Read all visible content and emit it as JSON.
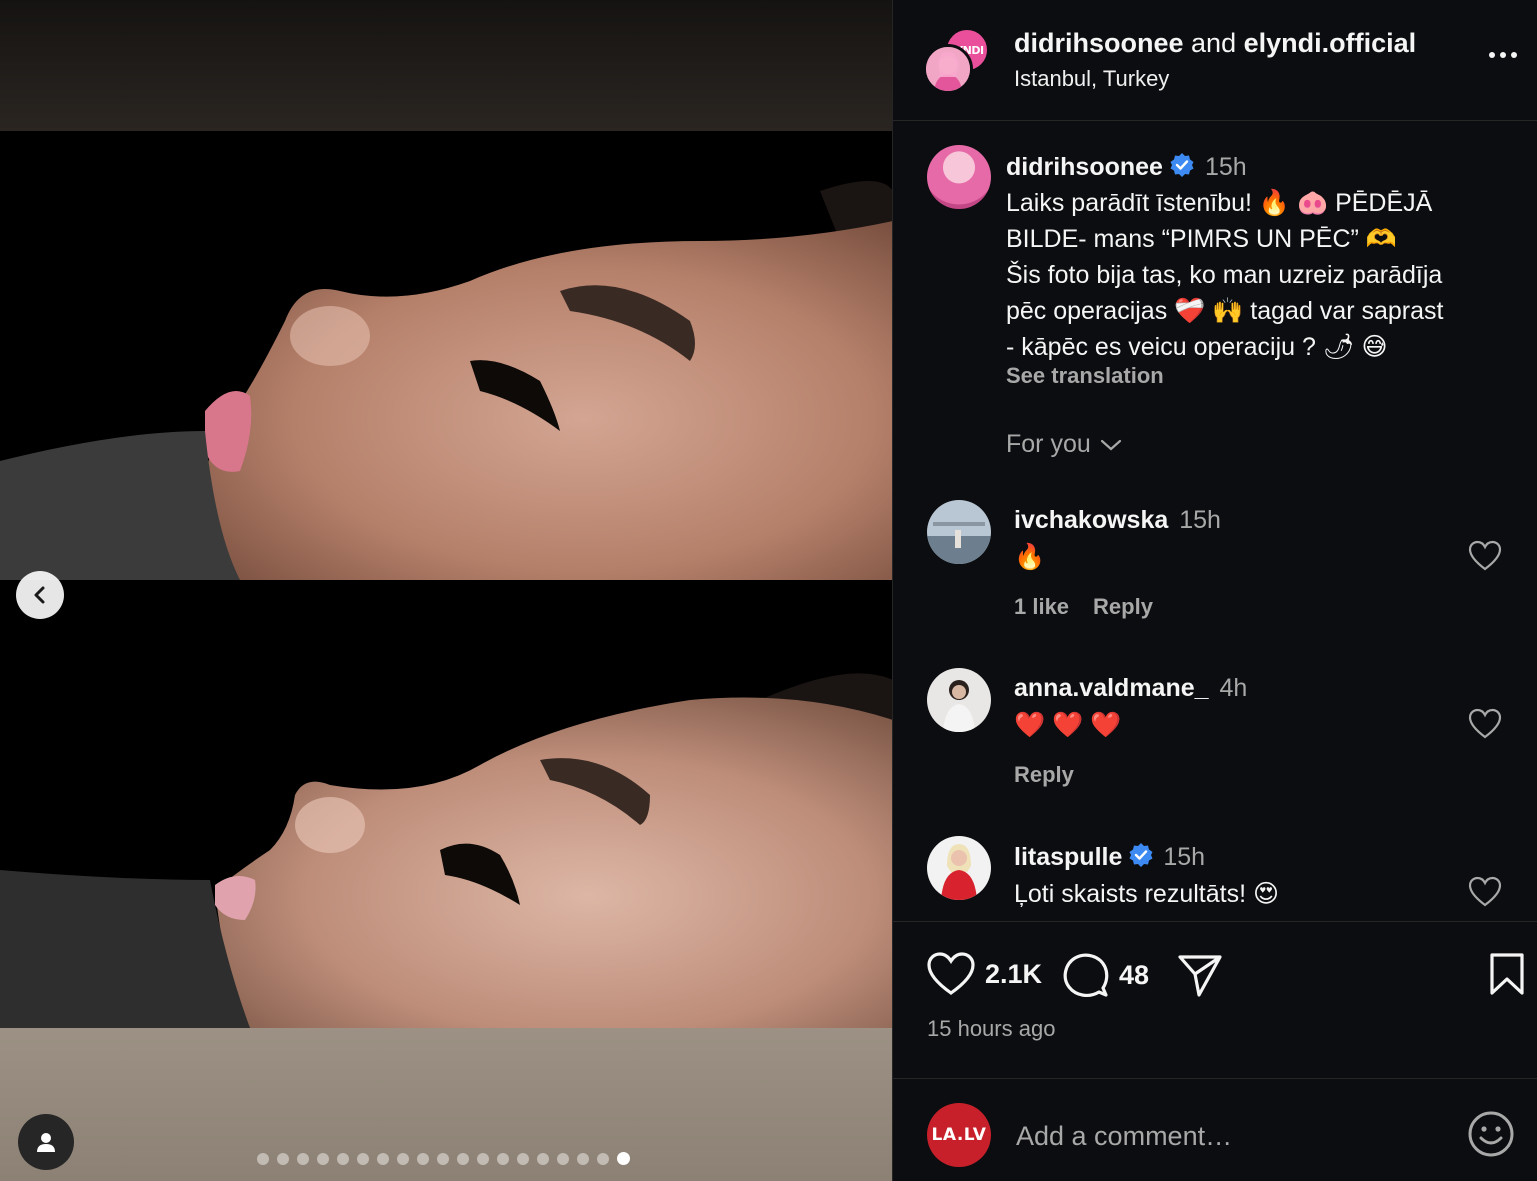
{
  "header": {
    "user1": "didrihsoonee",
    "and_text": "and",
    "user2": "elyndi.official",
    "location": "Istanbul, Turkey",
    "collab_logo_text": "LYNDI"
  },
  "caption": {
    "username": "didrihsoonee",
    "time": "15h",
    "lines": [
      "Laiks parādīt īstenību! 🔥 🐽 PĒDĒJĀ",
      "BILDE- mans “PIMRS UN PĒC” 🫶",
      "Šis foto bija tas, ko man uzreiz parādīja",
      "pēc operacijas ❤️‍🩹 🙌 tagad var saprast",
      "- kāpēc es veicu operaciju ? 🌶 😅"
    ],
    "see_translation": "See translation"
  },
  "sort_label": "For you",
  "comments": [
    {
      "username": "ivchakowska",
      "time": "15h",
      "text": "🔥",
      "likes": "1 like",
      "reply": "Reply",
      "verified": false
    },
    {
      "username": "anna.valdmane_",
      "time": "4h",
      "text": "❤️ ❤️ ❤️",
      "likes": "",
      "reply": "Reply",
      "verified": false
    },
    {
      "username": "litaspulle",
      "time": "15h",
      "text": "Ļoti skaists rezultāts! 😍",
      "likes": "",
      "reply": "",
      "verified": true
    }
  ],
  "actions": {
    "like_count": "2.1K",
    "comment_count": "48"
  },
  "posted_ago": "15 hours ago",
  "composer": {
    "avatar_text": "LA.LV",
    "placeholder": "Add a comment…"
  },
  "carousel": {
    "total": 19,
    "active_index": 18
  },
  "colors": {
    "panel_bg": "#0c0d10",
    "muted_text": "#a8a8a8",
    "verified_blue": "#3d8bf2",
    "divider": "#262626"
  }
}
